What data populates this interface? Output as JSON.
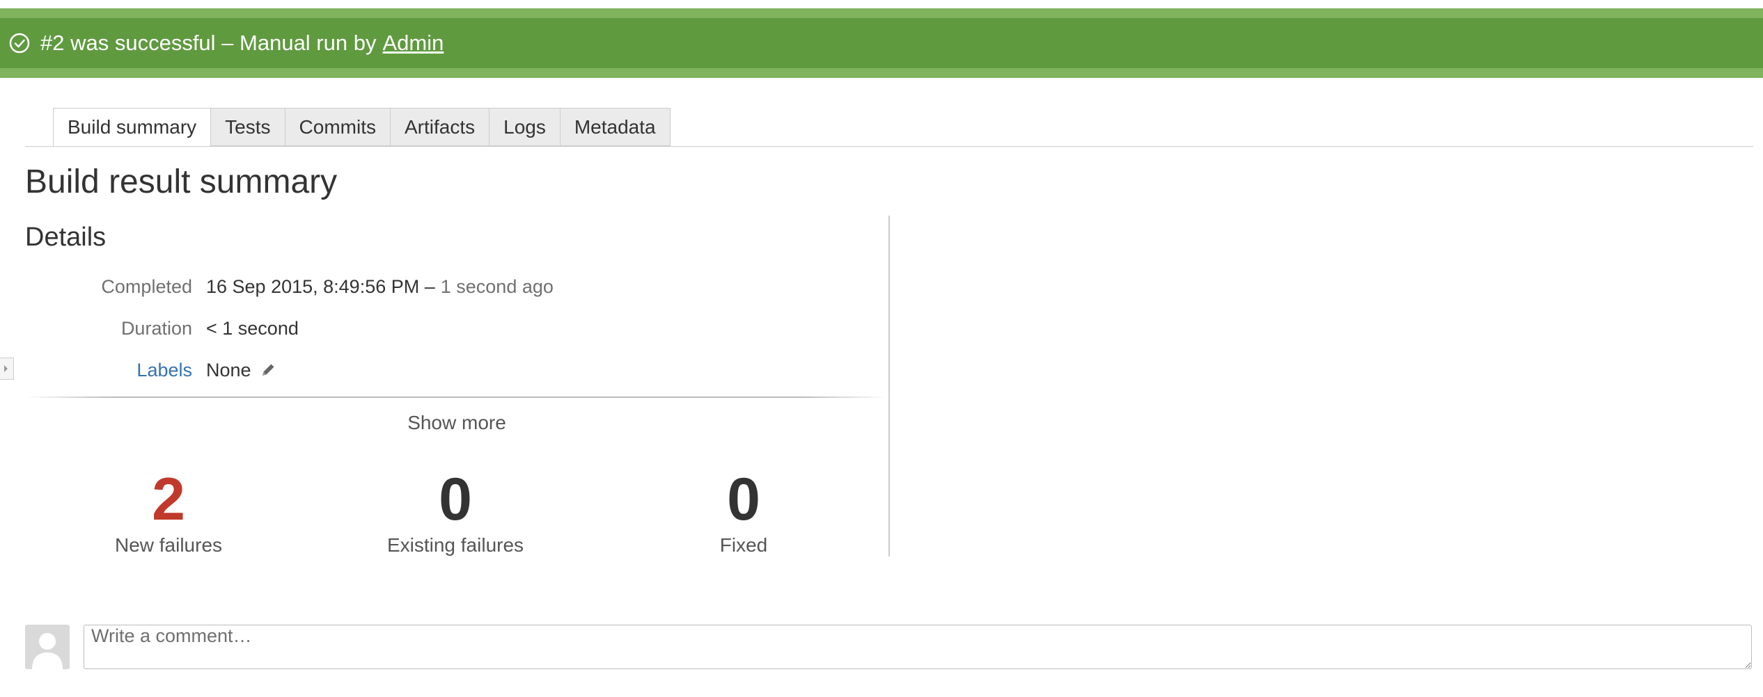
{
  "banner": {
    "status_text": "#2 was successful – Manual run by",
    "user_link": "Admin",
    "icon": "check-circle-icon",
    "color": "#5f9a3f"
  },
  "tabs": [
    {
      "label": "Build summary",
      "active": true
    },
    {
      "label": "Tests",
      "active": false
    },
    {
      "label": "Commits",
      "active": false
    },
    {
      "label": "Artifacts",
      "active": false
    },
    {
      "label": "Logs",
      "active": false
    },
    {
      "label": "Metadata",
      "active": false
    }
  ],
  "page_title": "Build result summary",
  "details": {
    "title": "Details",
    "completed_label": "Completed",
    "completed_value": "16 Sep 2015, 8:49:56 PM –",
    "completed_relative": "1 second ago",
    "duration_label": "Duration",
    "duration_value": "< 1 second",
    "labels_label": "Labels",
    "labels_value": "None",
    "show_more": "Show more"
  },
  "stats": [
    {
      "value": "2",
      "caption": "New failures",
      "color": "#c0392b"
    },
    {
      "value": "0",
      "caption": "Existing failures",
      "color": "#333333"
    },
    {
      "value": "0",
      "caption": "Fixed",
      "color": "#333333"
    }
  ],
  "comment": {
    "placeholder": "Write a comment…"
  }
}
